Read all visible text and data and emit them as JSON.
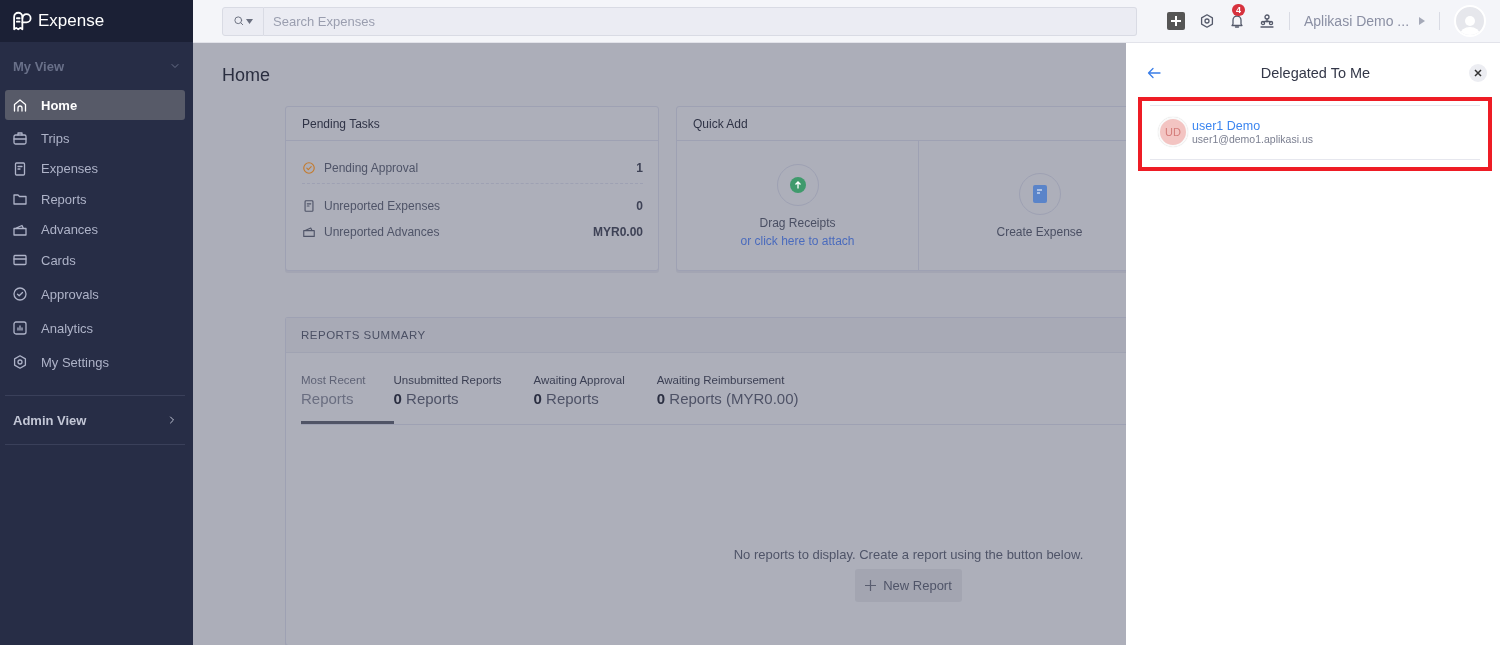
{
  "app": {
    "name": "Expense"
  },
  "sidebar": {
    "sections": [
      {
        "title": "My View",
        "expanded": true,
        "items": [
          {
            "label": "Home",
            "selected": true
          },
          {
            "label": "Trips",
            "selected": false
          },
          {
            "label": "Expenses",
            "selected": false
          },
          {
            "label": "Reports",
            "selected": false
          },
          {
            "label": "Advances",
            "selected": false
          },
          {
            "label": "Cards",
            "selected": false
          },
          {
            "label": "Approvals",
            "selected": false
          },
          {
            "label": "Analytics",
            "selected": false
          },
          {
            "label": "My Settings",
            "selected": false
          }
        ]
      },
      {
        "title": "Admin View",
        "expanded": false
      }
    ]
  },
  "topbar": {
    "search": {
      "placeholder": "Search Expenses"
    },
    "notification_count": "4",
    "org_name": "Aplikasi Demo ..."
  },
  "page": {
    "title": "Home"
  },
  "pending_tasks": {
    "title": "Pending Tasks",
    "rows": [
      {
        "label": "Pending Approval",
        "value": "1"
      },
      {
        "label": "Unreported Expenses",
        "value": "0"
      },
      {
        "label": "Unreported Advances",
        "value": "MYR0.00"
      }
    ]
  },
  "quick_add": {
    "title": "Quick Add",
    "actions": [
      {
        "kind": "upload",
        "label": "Drag Receipts",
        "link": "or click here to attach"
      },
      {
        "kind": "create",
        "label": "Create Expense"
      }
    ]
  },
  "reports_summary": {
    "title": "REPORTS SUMMARY",
    "tabs": [
      {
        "label": "Most Recent",
        "value": "Reports",
        "selected": true
      },
      {
        "label": "Unsubmitted Reports",
        "value": "**0** Reports",
        "selected": false
      },
      {
        "label": "Awaiting Approval",
        "value": "**0** Reports",
        "selected": false
      },
      {
        "label": "Awaiting Reimbursement",
        "value": "**0** Reports (MYR0.00)",
        "selected": false
      }
    ],
    "empty_message": "No reports to display. Create a report using the button below.",
    "new_button": "New Report"
  },
  "delegation_panel": {
    "title": "Delegated To Me",
    "users": [
      {
        "initials": "UD",
        "name": "user1 Demo",
        "email": "user1@demo1.aplikasi.us"
      }
    ]
  }
}
